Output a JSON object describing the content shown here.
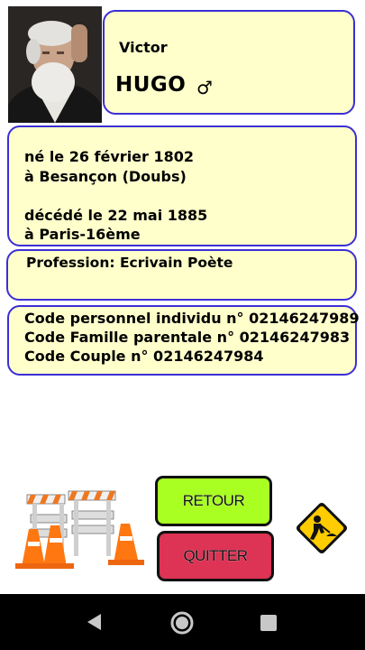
{
  "person": {
    "first_name": "Victor",
    "last_name": "HUGO",
    "gender_symbol": "♂",
    "portrait": "portrait-photo"
  },
  "life": {
    "birth_date": "né le 26 février 1802",
    "birth_place": "à Besançon (Doubs)",
    "death_date": "décédé le 22 mai 1885",
    "death_place": "à Paris-16ème"
  },
  "profession": "Profession: Ecrivain Poète",
  "codes": {
    "personal": "Code personnel individu n° 02146247989",
    "family": "Code Famille parentale n° 02146247983",
    "couple": "Code Couple  n° 02146247984"
  },
  "buttons": {
    "back_label": "RETOUR",
    "quit_label": "QUITTER"
  },
  "icons": {
    "barriers": "construction-barriers-icon",
    "worker_sign": "roadwork-sign-icon"
  },
  "navigation": {
    "back": "back-triangle-icon",
    "home": "home-circle-icon",
    "recents": "recents-square-icon"
  },
  "colors": {
    "card_bg": "#ffffcc",
    "card_border": "#3b2fd6",
    "back_button": "#aaff22",
    "quit_button": "#dd3355"
  }
}
